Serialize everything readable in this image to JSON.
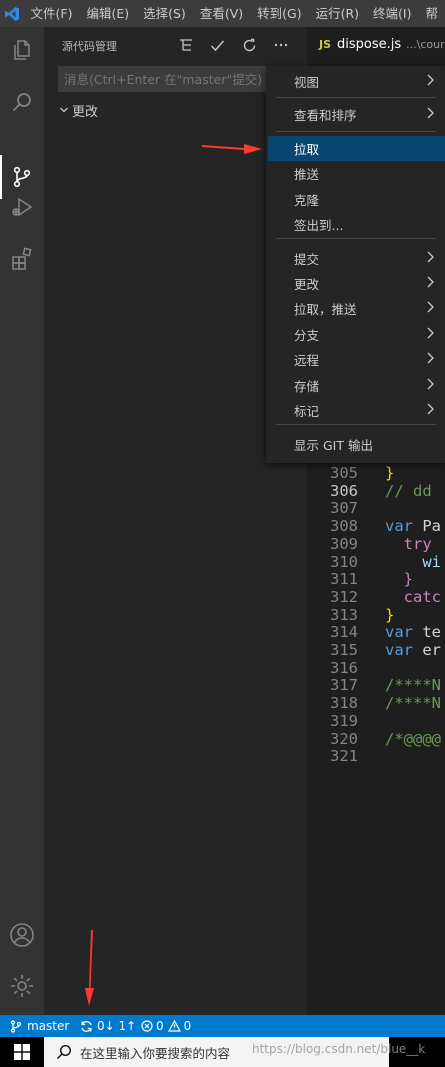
{
  "menubar": {
    "items": [
      "文件(F)",
      "编辑(E)",
      "选择(S)",
      "查看(V)",
      "转到(G)",
      "运行(R)",
      "终端(I)",
      "帮"
    ]
  },
  "activitybar": {
    "icons": [
      "explorer-icon",
      "search-icon",
      "source-control-icon",
      "run-debug-icon",
      "extensions-icon",
      "account-icon",
      "settings-gear-icon"
    ]
  },
  "sidebar": {
    "title": "源代码管理",
    "commit_placeholder": "消息(Ctrl+Enter 在\"master\"提交)",
    "changes_label": "更改"
  },
  "tab": {
    "badge": "JS",
    "filename": "dispose.js",
    "path": "...\\course"
  },
  "editor": {
    "lines": [
      {
        "num": "305",
        "tokens": [
          [
            "br",
            "}"
          ]
        ]
      },
      {
        "num": "306",
        "tokens": [
          [
            "cm",
            "// dd"
          ]
        ]
      },
      {
        "num": "307",
        "tokens": []
      },
      {
        "num": "308",
        "tokens": [
          [
            "kw",
            "var "
          ],
          [
            "id",
            "Pa"
          ]
        ]
      },
      {
        "num": "309",
        "tokens": [
          [
            "id",
            "  "
          ],
          [
            "ctl",
            "try"
          ],
          [
            "id",
            " "
          ]
        ]
      },
      {
        "num": "310",
        "tokens": [
          [
            "id",
            "    "
          ],
          [
            "fn",
            "wi"
          ]
        ]
      },
      {
        "num": "311",
        "tokens": [
          [
            "id",
            "  "
          ],
          [
            "ctl",
            "}"
          ]
        ]
      },
      {
        "num": "312",
        "tokens": [
          [
            "id",
            "  "
          ],
          [
            "ctl",
            "catc"
          ]
        ]
      },
      {
        "num": "313",
        "tokens": [
          [
            "br",
            "}"
          ]
        ]
      },
      {
        "num": "314",
        "tokens": [
          [
            "kw",
            "var "
          ],
          [
            "id",
            "te"
          ]
        ]
      },
      {
        "num": "315",
        "tokens": [
          [
            "kw",
            "var "
          ],
          [
            "id",
            "er"
          ]
        ]
      },
      {
        "num": "316",
        "tokens": []
      },
      {
        "num": "317",
        "tokens": [
          [
            "cm",
            "/****N"
          ]
        ]
      },
      {
        "num": "318",
        "tokens": [
          [
            "cm",
            "/****N"
          ]
        ]
      },
      {
        "num": "319",
        "tokens": []
      },
      {
        "num": "320",
        "tokens": [
          [
            "cm",
            "/*@@@@"
          ]
        ]
      },
      {
        "num": "321",
        "tokens": []
      }
    ]
  },
  "context_menu": {
    "items": [
      {
        "label": "视图",
        "submenu": true
      },
      {
        "label": "查看和排序",
        "submenu": true
      },
      {
        "label": "拉取",
        "submenu": false,
        "highlighted": true
      },
      {
        "label": "推送",
        "submenu": false
      },
      {
        "label": "克隆",
        "submenu": false
      },
      {
        "label": "签出到...",
        "submenu": false
      },
      {
        "label": "提交",
        "submenu": true
      },
      {
        "label": "更改",
        "submenu": true
      },
      {
        "label": "拉取，推送",
        "submenu": true
      },
      {
        "label": "分支",
        "submenu": true
      },
      {
        "label": "远程",
        "submenu": true
      },
      {
        "label": "存储",
        "submenu": true
      },
      {
        "label": "标记",
        "submenu": true
      },
      {
        "label": "显示 GIT 输出",
        "submenu": false
      }
    ]
  },
  "statusbar": {
    "branch": "master",
    "sync": "0↓ 1↑",
    "errors": "0",
    "warnings": "0"
  },
  "taskbar": {
    "search_placeholder": "在这里输入你要搜索的内容"
  },
  "watermark": "https://blog.csdn.net/blue__k",
  "colors": {
    "accent": "#007acc",
    "menu_highlight": "#094771",
    "arrow": "#ff3b30"
  }
}
